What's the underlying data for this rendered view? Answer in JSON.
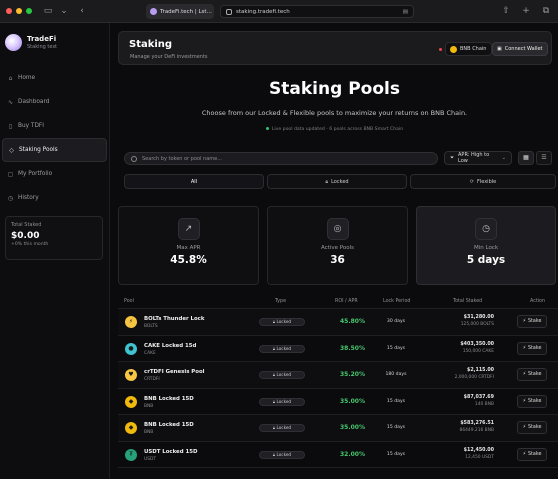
{
  "browser": {
    "tab_title": "TradeFi.tech | Lst...",
    "url": "staking.tradefi.tech"
  },
  "brand": {
    "name": "TradeFi",
    "subtitle": "Staking test"
  },
  "sidebar": {
    "items": [
      {
        "label": "Home",
        "icon": "home-icon"
      },
      {
        "label": "Dashboard",
        "icon": "chart-icon"
      },
      {
        "label": "Buy TDFI",
        "icon": "cart-icon"
      },
      {
        "label": "Staking Pools",
        "icon": "layers-icon",
        "active": true
      },
      {
        "label": "My Portfolio",
        "icon": "wallet-icon"
      },
      {
        "label": "History",
        "icon": "clock-icon"
      }
    ],
    "staked": {
      "label": "Total Staked",
      "value": "$0.00",
      "sub": "+0% this month"
    }
  },
  "header": {
    "title": "Staking",
    "subtitle": "Manage your DeFi investments",
    "chain": "BNB Chain",
    "connect": "Connect Wallet"
  },
  "hero": {
    "title": "Staking Pools",
    "subtitle": "Choose from our Locked & Flexible pools to maximize your returns on BNB Chain.",
    "note": "Live pool data updated · 6 pools across BNB Smart Chain"
  },
  "search": {
    "placeholder": "Search by token or pool name..."
  },
  "sort": {
    "label": "APR: High to Low"
  },
  "filters": [
    {
      "label": "All",
      "active": true
    },
    {
      "label": "Locked",
      "active": false
    },
    {
      "label": "Flexible",
      "active": false
    }
  ],
  "stats": [
    {
      "label": "Max APR",
      "value": "45.8%",
      "icon": "trend-up-icon"
    },
    {
      "label": "Active Pools",
      "value": "36",
      "icon": "target-icon"
    },
    {
      "label": "Min Lock",
      "value": "5 days",
      "icon": "clock-icon"
    }
  ],
  "table": {
    "headers": [
      "Pool",
      "Type",
      "ROI / APR",
      "Lock Period",
      "Total Staked",
      "Action"
    ],
    "rows": [
      {
        "name": "BOLTs Thunder Lock",
        "symbol": "BOLTS",
        "type": "Locked",
        "apr": "45.80%",
        "lock": "30 days",
        "staked": "$31,280.00",
        "staked_sub": "125,000 BOLTS",
        "color": "#f5c542",
        "glyph": "⚡",
        "action": "Stake"
      },
      {
        "name": "CAKE Locked 15d",
        "symbol": "CAKE",
        "type": "Locked",
        "apr": "38.50%",
        "lock": "15 days",
        "staked": "$403,350.00",
        "staked_sub": "150,000 CAKE",
        "color": "#3ec3d0",
        "glyph": "●",
        "action": "Stake"
      },
      {
        "name": "crTDFI Genesis Pool",
        "symbol": "CRTDFI",
        "type": "Locked",
        "apr": "35.20%",
        "lock": "180 days",
        "staked": "$2,115.00",
        "staked_sub": "2,000,000 CRTDFI",
        "color": "#f7c744",
        "glyph": "♥",
        "action": "Stake"
      },
      {
        "name": "BNB Locked 15D",
        "symbol": "BNB",
        "type": "Locked",
        "apr": "35.00%",
        "lock": "15 days",
        "staked": "$87,037.69",
        "staked_sub": "140 BNB",
        "color": "#f0b90b",
        "glyph": "◆",
        "action": "Stake"
      },
      {
        "name": "BNB Locked 15D",
        "symbol": "BNB",
        "type": "Locked",
        "apr": "35.00%",
        "lock": "15 days",
        "staked": "$583,276.51",
        "staked_sub": "86449.216 BNB",
        "color": "#f0b90b",
        "glyph": "◆",
        "action": "Stake"
      },
      {
        "name": "USDT Locked 15D",
        "symbol": "USDT",
        "type": "Locked",
        "apr": "32.00%",
        "lock": "15 days",
        "staked": "$12,450.00",
        "staked_sub": "12,450 USDT",
        "color": "#26a17b",
        "glyph": "₮",
        "action": "Stake"
      }
    ]
  },
  "colors": {
    "accent_green": "#46c86e",
    "bnb": "#f0b90b",
    "status_red": "#e5484d"
  }
}
